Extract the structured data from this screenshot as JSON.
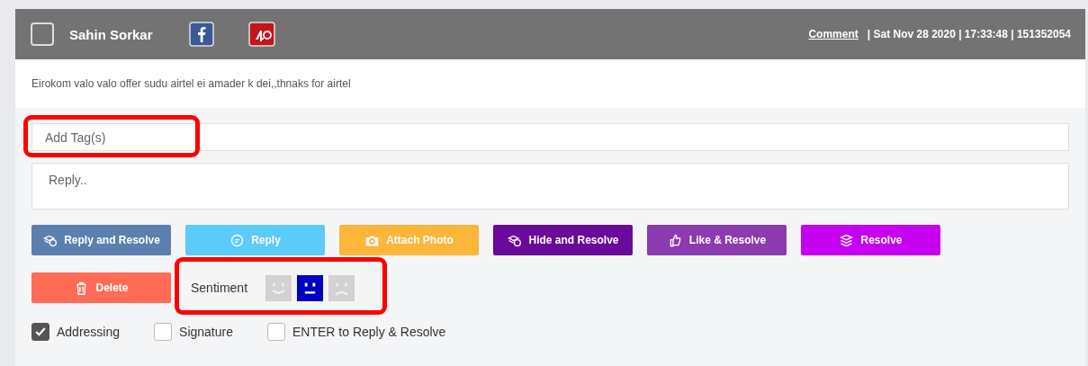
{
  "header": {
    "selected": false,
    "author": "Sahin Sorkar",
    "link": "Comment",
    "meta": "| Sat Nov 28 2020 | 17:33:48 | 151352054"
  },
  "message": "Eirokom valo valo offer sudu airtel ei amader k dei,,thnaks for airtel",
  "tag_field": {
    "placeholder": "Add Tag(s)"
  },
  "reply_field": {
    "placeholder": "Reply.."
  },
  "buttons": [
    {
      "label": "Reply and Resolve",
      "kind": "layers-chat",
      "color": "#5b7fae"
    },
    {
      "label": "Reply",
      "kind": "chat",
      "color": "#5bcbfa"
    },
    {
      "label": "Attach Photo",
      "kind": "camera",
      "color": "#fdb53a"
    },
    {
      "label": "Hide and Resolve",
      "kind": "layers-chat",
      "color": "#6a0a9a"
    },
    {
      "label": "Like & Resolve",
      "kind": "thumb",
      "color": "#8c3ab0"
    },
    {
      "label": "Resolve",
      "kind": "layers",
      "color": "#c600f0"
    },
    {
      "label": "Delete",
      "kind": "trash",
      "color": "#ff6b55"
    }
  ],
  "sentiment": {
    "label": "Sentiment",
    "options": [
      {
        "kind": "happy",
        "selected": false
      },
      {
        "kind": "neutral",
        "selected": true
      },
      {
        "kind": "sad",
        "selected": false
      }
    ]
  },
  "options": [
    {
      "label": "Addressing",
      "checked": true
    },
    {
      "label": "Signature",
      "checked": false
    },
    {
      "label": "ENTER to Reply & Resolve",
      "checked": false
    }
  ]
}
